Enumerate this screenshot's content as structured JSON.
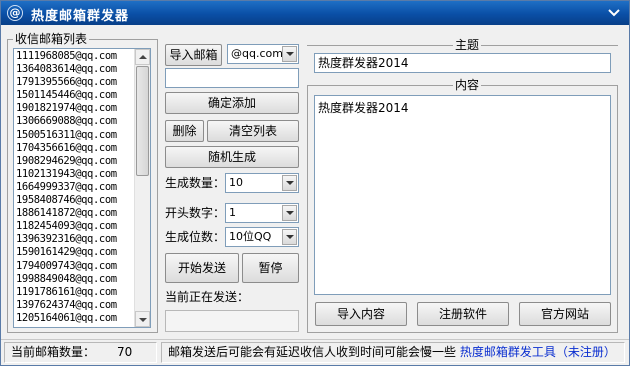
{
  "window": {
    "title": "热度邮箱群发器",
    "app_icon": "@"
  },
  "list_panel": {
    "label": "收信邮箱列表",
    "emails": [
      "1111968085@qq.com",
      "1364083614@qq.com",
      "1791395566@qq.com",
      "1501145446@qq.com",
      "1901821974@qq.com",
      "1306669088@qq.com",
      "1500516311@qq.com",
      "1704356616@qq.com",
      "1908294629@qq.com",
      "1102131943@qq.com",
      "1664999337@qq.com",
      "1958408746@qq.com",
      "1886141872@qq.com",
      "1182454093@qq.com",
      "1396392316@qq.com",
      "1590161429@qq.com",
      "1794009743@qq.com",
      "1998849048@qq.com",
      "1191786161@qq.com",
      "1397624374@qq.com",
      "1205164061@qq.com"
    ]
  },
  "controls": {
    "import_label": "导入邮箱",
    "domain_selected": "@qq.com",
    "new_email_value": "",
    "confirm_add_label": "确定添加",
    "delete_label": "删除",
    "clear_list_label": "清空列表",
    "random_generate_label": "随机生成",
    "count_label": "生成数量：",
    "count_value": "10",
    "prefix_label": "开头数字：",
    "prefix_value": "1",
    "digits_label": "生成位数：",
    "digits_value": "10位QQ",
    "start_label": "开始发送",
    "pause_label": "暂停",
    "sending_label": "当前正在发送：",
    "sending_value": ""
  },
  "subject": {
    "label": "主题",
    "value": "热度群发器2014"
  },
  "body": {
    "label": "内容",
    "value": "热度群发器2014"
  },
  "bottom_buttons": {
    "import_content": "导入内容",
    "register": "注册软件",
    "website": "官方网站"
  },
  "status": {
    "count_label": "当前邮箱数量：",
    "count_value": "70",
    "message": "邮箱发送后可能会有延迟收信人收到时间可能会慢一些",
    "product_link": "热度邮箱群发工具（未注册）"
  },
  "colors": {
    "titlebar": "#0a4fa6",
    "link": "#0a2ed0"
  }
}
